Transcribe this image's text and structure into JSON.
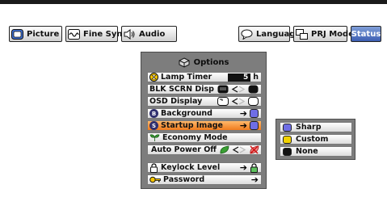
{
  "tabs": [
    {
      "label": "Picture",
      "icon": "picture-icon"
    },
    {
      "label": "Fine Sync",
      "icon": "wave-icon"
    },
    {
      "label": "Audio",
      "icon": "speaker-icon"
    },
    {
      "label": "Language",
      "icon": "speech-bubble-icon"
    },
    {
      "label": "PRJ Mode",
      "icon": "projector-mode-icon"
    },
    {
      "label": "Status",
      "icon": "none"
    }
  ],
  "menu": {
    "title": "Options",
    "title_icon": "options-cube-icon",
    "items": [
      {
        "label": "Lamp Timer",
        "value": "5",
        "unit": "h",
        "icon": "hourglass-icon"
      },
      {
        "label": "BLK SCRN Disp",
        "icon": "none"
      },
      {
        "label": "OSD Display",
        "icon": "none"
      },
      {
        "label": "Background",
        "icon": "B-badge-icon",
        "badge": "B"
      },
      {
        "label": "Startup Image",
        "icon": "S-badge-icon",
        "badge": "S",
        "highlighted": true
      },
      {
        "label": "Economy Mode",
        "icon": "leaf-icon"
      },
      {
        "label": "Auto Power Off",
        "icon": "none"
      },
      {
        "label": "Keylock Level",
        "icon": "lock-icon"
      },
      {
        "label": "Password",
        "icon": "key-icon"
      }
    ]
  },
  "submenu": {
    "items": [
      {
        "label": "Sharp",
        "color": "#6f6ee6"
      },
      {
        "label": "Custom",
        "color": "#f2d200"
      },
      {
        "label": "None",
        "color": "#111111"
      }
    ]
  },
  "colors": {
    "highlight": "#f07c1e",
    "active_tab": "#3c5eb2",
    "menu_bg": "#7d7d7d"
  }
}
